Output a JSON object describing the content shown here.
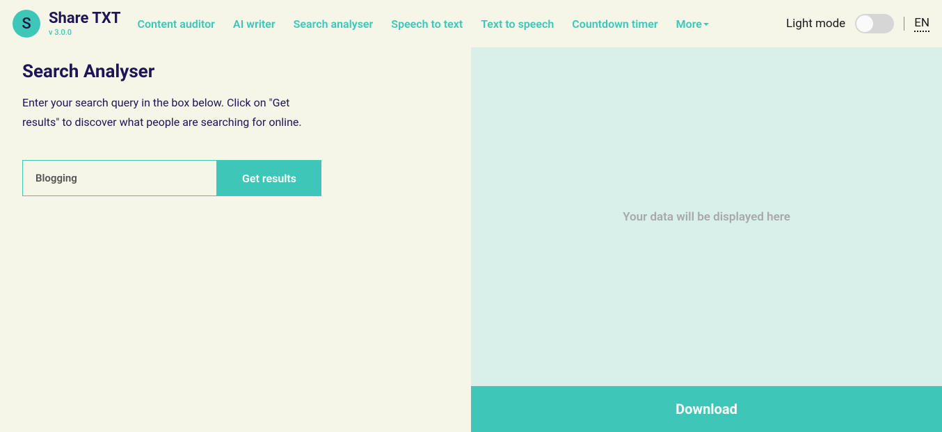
{
  "header": {
    "logo_letter": "S",
    "title": "Share TXT",
    "version": "v 3.0.0",
    "nav": {
      "content_auditor": "Content auditor",
      "ai_writer": "AI writer",
      "search_analyser": "Search analyser",
      "speech_to_text": "Speech to text",
      "text_to_speech": "Text to speech",
      "countdown_timer": "Countdown timer",
      "more": "More"
    },
    "mode_label": "Light mode",
    "lang": "EN"
  },
  "main": {
    "title": "Search Analyser",
    "description": "Enter your search query in the box below. Click on \"Get results\" to discover what people are searching for online.",
    "search_value": "Blogging",
    "get_results_label": "Get results"
  },
  "results": {
    "placeholder": "Your data will be displayed here",
    "download_label": "Download"
  }
}
